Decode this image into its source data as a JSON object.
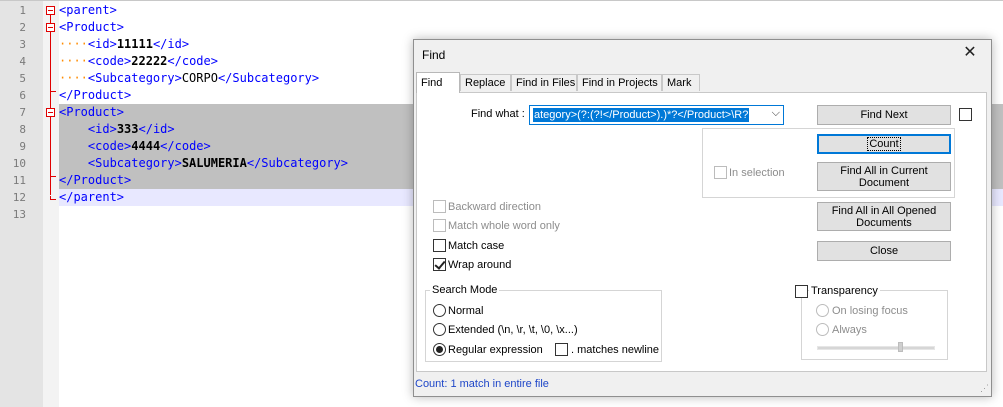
{
  "editor": {
    "line_numbers": [
      "1",
      "2",
      "3",
      "4",
      "5",
      "6",
      "7",
      "8",
      "9",
      "10",
      "11",
      "12",
      "13"
    ],
    "lines": [
      {
        "open": "<parent>"
      },
      {
        "open": "<Product>"
      },
      {
        "dots": "····",
        "open": "<id>",
        "value": "11111",
        "close": "</id>"
      },
      {
        "dots": "····",
        "open": "<code>",
        "value": "22222",
        "close": "</code>"
      },
      {
        "dots": "····",
        "open": "<Subcategory>",
        "value": "CORPO",
        "close": "</Subcategory>"
      },
      {
        "close": "</Product>"
      },
      {
        "open": "<Product>"
      },
      {
        "indent": "    ",
        "open": "<id>",
        "value": "333",
        "close": "</id>"
      },
      {
        "indent": "    ",
        "open": "<code>",
        "value": "4444",
        "close": "</code>"
      },
      {
        "indent": "    ",
        "open": "<Subcategory>",
        "value": "SALUMERIA",
        "close": "</Subcategory>"
      },
      {
        "close": "</Product>"
      },
      {
        "close": "</parent>"
      }
    ]
  },
  "dialog": {
    "title": "Find",
    "close_symbol": "✕",
    "tabs": [
      "Find",
      "Replace",
      "Find in Files",
      "Find in Projects",
      "Mark"
    ],
    "find_what_label": "Find what :",
    "find_what_value": "ategory>(?:(?!</Product>).)*?</Product>\\R?",
    "buttons": {
      "find_next": "Find Next",
      "count": "Count",
      "find_all_current_1": "Find All in Current",
      "find_all_current_2": "Document",
      "find_all_opened_1": "Find All in All Opened",
      "find_all_opened_2": "Documents",
      "close": "Close"
    },
    "in_selection": "In selection",
    "options": {
      "backward": "Backward direction",
      "whole_word": "Match whole word only",
      "match_case": "Match case",
      "wrap_around": "Wrap around"
    },
    "search_mode": {
      "title": "Search Mode",
      "normal": "Normal",
      "extended": "Extended (\\n, \\r, \\t, \\0, \\x...)",
      "regex": "Regular expression",
      "matches_newline": ". matches newline"
    },
    "transparency": {
      "title": "Transparency",
      "on_losing_focus": "On losing focus",
      "always": "Always"
    },
    "status": "Count: 1 match in entire file"
  }
}
